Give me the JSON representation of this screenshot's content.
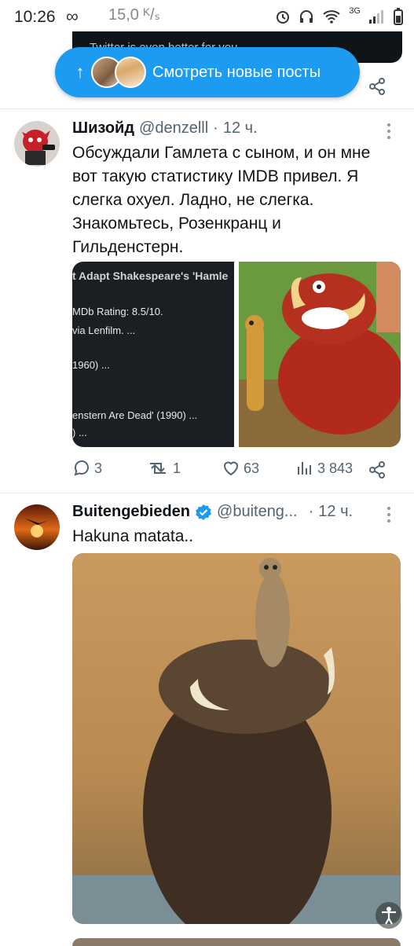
{
  "status_bar": {
    "time": "10:26",
    "infinity": "∞",
    "speed": "15,0 ᴷ/ₛ",
    "network": "3G"
  },
  "prev_tweet": {
    "text_fragment": "Twitter is even better for you"
  },
  "new_posts_pill": {
    "label": "Смотреть новые посты"
  },
  "tweets": [
    {
      "author_name": "Шизойд",
      "author_handle": "@denzelll",
      "dot": "·",
      "time": "12 ч.",
      "text_lines": [
        "Обсуждали Гамлета с сыном, и он мне",
        "вот такую статистику IMDB привел. Я",
        "слегка охуел. Ладно, не слегка.",
        "Знакомьтесь, Розенкранц и",
        "Гильденстерн."
      ],
      "media_screenshot_lines": [
        "t Adapt Shakespeare's 'Hamle",
        "MDb Rating: 8.5/10.",
        "via Lenfilm. ...",
        "1960) ...",
        "enstern Are Dead' (1990) ...",
        ") ..."
      ],
      "replies": "3",
      "reposts": "1",
      "likes": "63",
      "views": "3 843"
    },
    {
      "author_name": "Buitengebieden",
      "author_handle": "@buiteng...",
      "dot": "·",
      "time": "12 ч.",
      "text": "Hakuna matata.."
    }
  ],
  "colors": {
    "accent": "#1d9bf0",
    "text": "#0f1419",
    "muted": "#536471",
    "divider": "#e1e8ed"
  }
}
